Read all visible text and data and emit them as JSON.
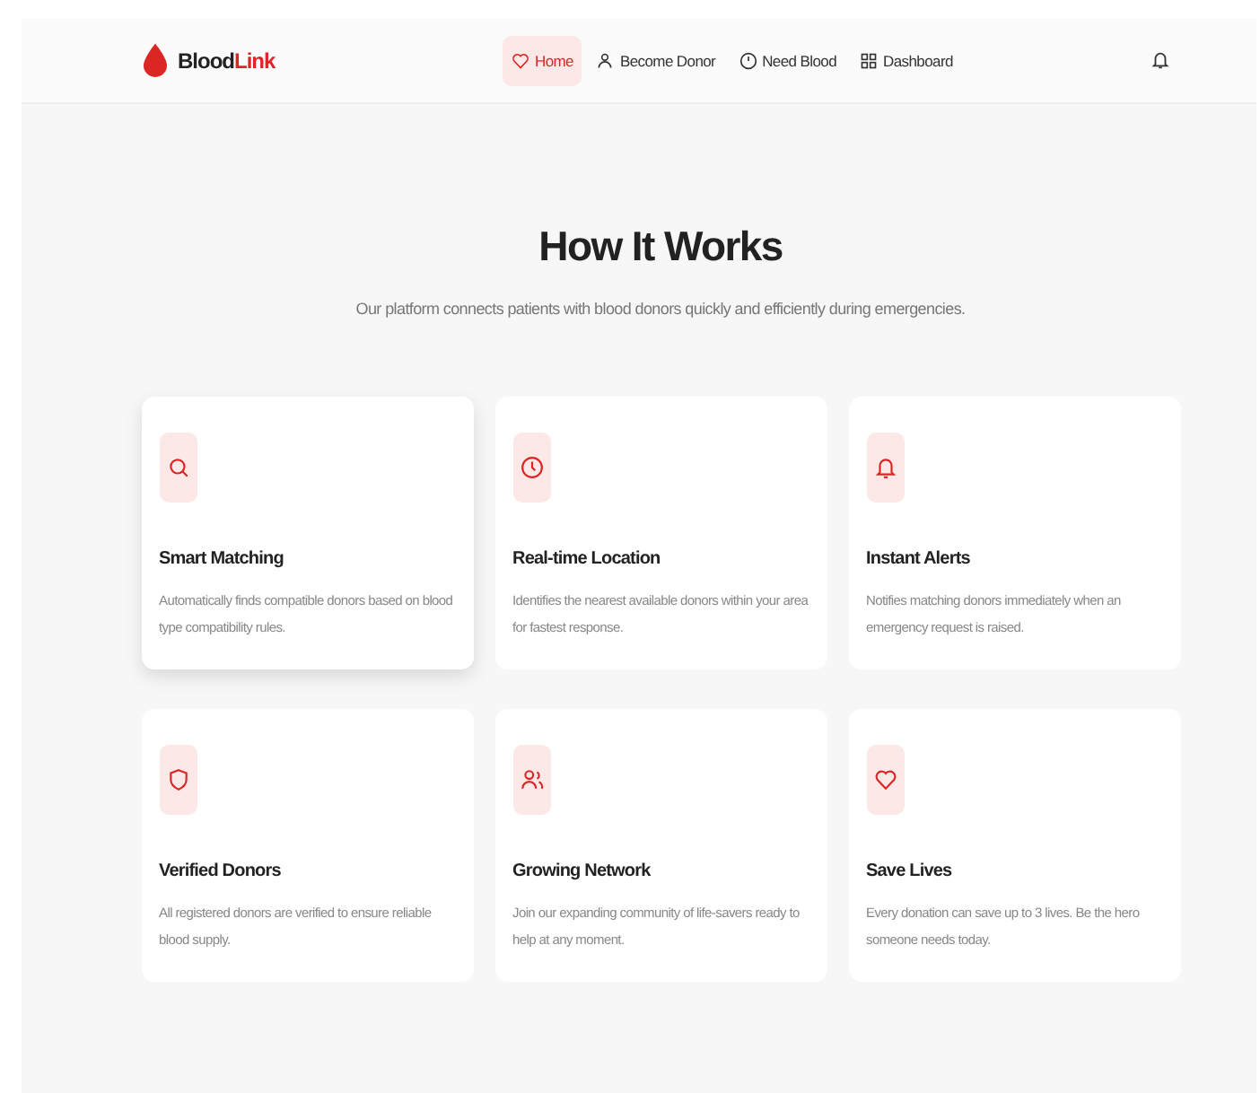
{
  "header": {
    "logo": {
      "dark": "Blood",
      "accent": "Link"
    },
    "nav": [
      {
        "label": "Home",
        "selected": true
      },
      {
        "label": "Become Donor",
        "selected": false
      },
      {
        "label": "Need Blood",
        "selected": false
      },
      {
        "label": "Dashboard",
        "selected": false
      }
    ]
  },
  "section": {
    "title": "How It Works",
    "subtitle": "Our platform connects patients with blood donors quickly and efficiently during emergencies."
  },
  "features": [
    {
      "title": "Smart Matching",
      "text": "Automatically finds compatible donors based on blood type compatibility rules.",
      "raised": true
    },
    {
      "title": "Real-time Location",
      "text": "Identifies the nearest available donors within your area for fastest response.",
      "raised": false
    },
    {
      "title": "Instant Alerts",
      "text": "Notifies matching donors immediately when an emergency request is raised.",
      "raised": false
    },
    {
      "title": "Verified Donors",
      "text": "All registered donors are verified to ensure reliable blood supply.",
      "raised": false
    },
    {
      "title": "Growing Network",
      "text": "Join our expanding community of life-savers ready to help at any moment.",
      "raised": false
    },
    {
      "title": "Save Lives",
      "text": "Every donation can save up to 3 lives. Be the hero someone needs today.",
      "raised": false
    }
  ]
}
